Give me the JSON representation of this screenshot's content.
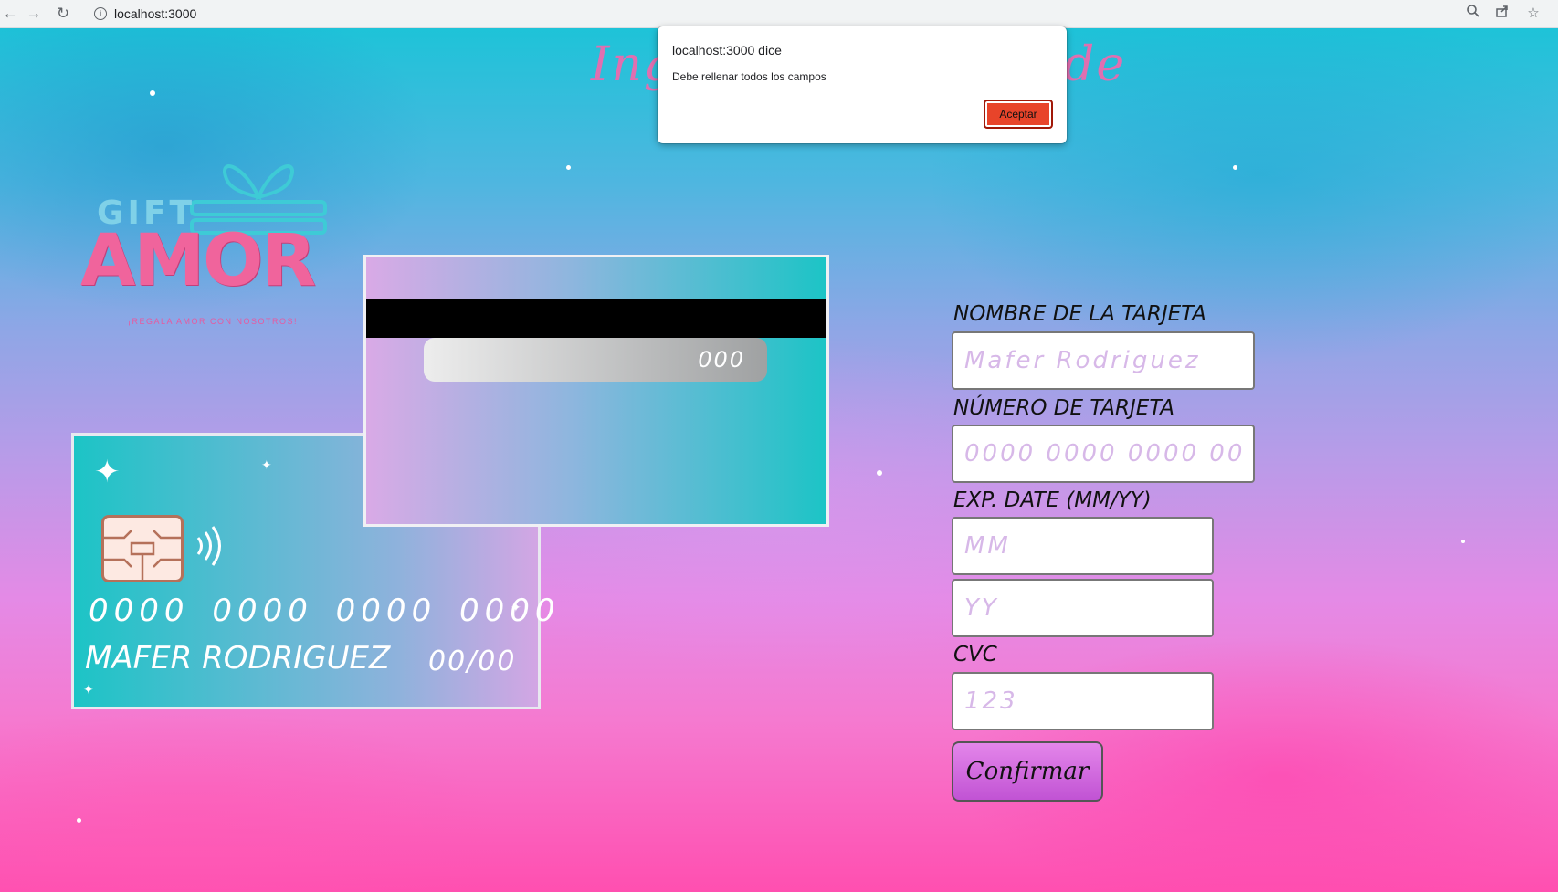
{
  "browser": {
    "url": "localhost:3000",
    "icons": [
      "back-icon",
      "forward-icon",
      "reload-icon",
      "info-icon",
      "zoom-icon",
      "share-icon",
      "bookmark-star-icon"
    ]
  },
  "page": {
    "title": "Ingresa tu tarjeta de credito"
  },
  "logo": {
    "gift": "GIFT",
    "amor": "AMOR",
    "tagline": "¡REGALA AMOR CON NOSOTROS!"
  },
  "card_back": {
    "cvc": "000"
  },
  "card_front": {
    "number": "0000 0000 0000 0000",
    "name": "MAFER RODRIGUEZ",
    "expiry": "00/00"
  },
  "form": {
    "name_label": "NOMBRE DE LA TARJETA",
    "name_placeholder": "Mafer Rodriguez",
    "number_label": "NÚMERO DE TARJETA",
    "number_placeholder": "0000 0000 0000 0000",
    "exp_label": "EXP. DATE (MM/YY)",
    "mm_placeholder": "MM",
    "yy_placeholder": "YY",
    "cvc_label": "CVC",
    "cvc_placeholder": "123",
    "confirm_label": "Confirmar"
  },
  "dialog": {
    "title": "localhost:3000 dice",
    "message": "Debe rellenar todos los campos",
    "accept_label": "Aceptar"
  },
  "colors": {
    "accept_button": "#e8442a",
    "confirm_button": "#c153d4",
    "card_teal": "#1cc4c6",
    "card_pink": "#d9aae6"
  }
}
